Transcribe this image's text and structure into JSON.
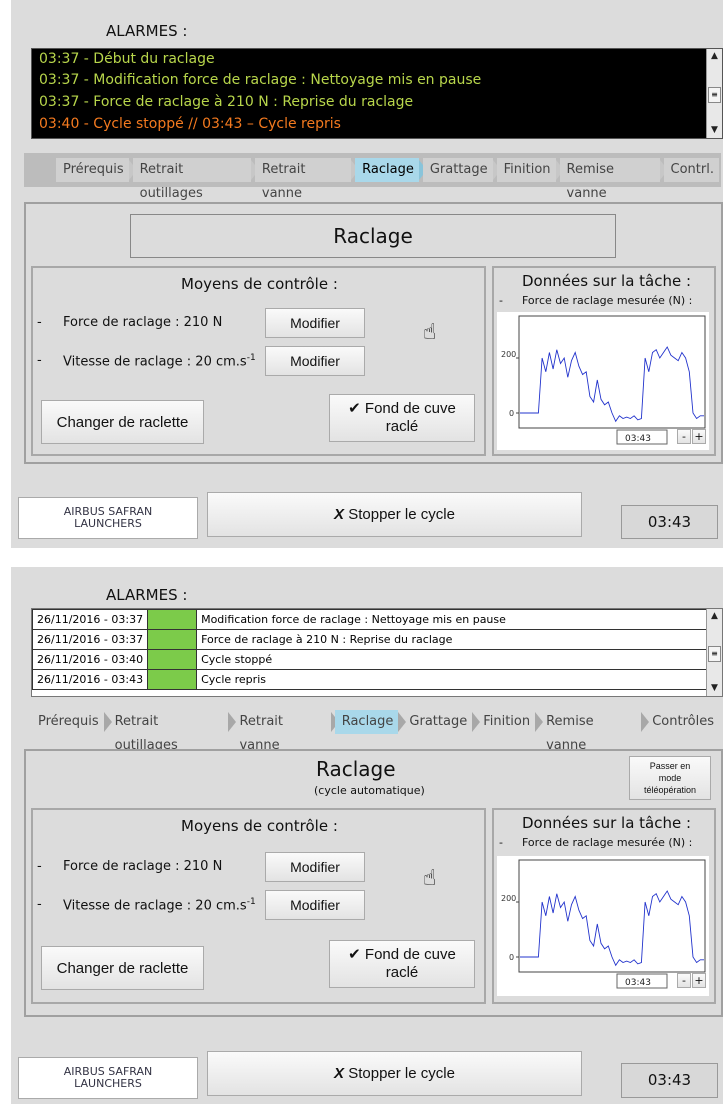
{
  "colors": {
    "alarm_green": "#b8d64b",
    "alarm_orange": "#f47a1f",
    "status_green": "#7ccb4a",
    "active_tab": "#a9d8ea",
    "chart_line": "#2233cc"
  },
  "screen1": {
    "alarm_title": "ALARMES :",
    "alarms": [
      {
        "text": "03:37 - Début du raclage",
        "color": "green"
      },
      {
        "text": "03:37 - Modification force de raclage : Nettoyage mis en pause",
        "color": "green"
      },
      {
        "text": "03:37 - Force de raclage à 210 N : Reprise du raclage",
        "color": "green"
      },
      {
        "text": "03:40 - Cycle stoppé // 03:43 – Cycle repris",
        "color": "orange"
      }
    ],
    "steps": [
      "Prérequis",
      "Retrait outillages",
      "Retrait vanne",
      "Raclage",
      "Grattage",
      "Finition",
      "Remise vanne",
      "Contrl."
    ],
    "active_step": "Raclage",
    "title": "Raclage",
    "controls_title": "Moyens de contrôle :",
    "force_label": "Force de raclage : 210 N",
    "speed_label": "Vitesse de raclage : 20 cm.s",
    "speed_exp": "-1",
    "modify_label": "Modifier",
    "change_label": "Changer de raclette",
    "fond_line1": "✔ Fond de cuve",
    "fond_line2": "raclé",
    "data_title": "Données sur la tâche :",
    "data_sub": "Force de raclage mesurée (N) :",
    "chart_time": "03:43",
    "minus": "-",
    "plus": "+",
    "logo_line1": "AIRBUS SAFRAN",
    "logo_line2": "LAUNCHERS",
    "stop_label": "Stopper le cycle",
    "stop_icon": "X",
    "time": "03:43"
  },
  "screen2": {
    "alarm_title": "ALARMES :",
    "alarms": [
      {
        "date": "26/11/2016 - 03:37",
        "msg": "Modification force de raclage : Nettoyage mis en pause"
      },
      {
        "date": "26/11/2016 - 03:37",
        "msg": "Force de raclage à 210 N : Reprise du raclage"
      },
      {
        "date": "26/11/2016 - 03:40",
        "msg": "Cycle stoppé"
      },
      {
        "date": "26/11/2016 - 03:43",
        "msg": "Cycle repris"
      }
    ],
    "steps": [
      "Prérequis",
      "Retrait outillages",
      "Retrait vanne",
      "Raclage",
      "Grattage",
      "Finition",
      "Remise vanne",
      "Contrôles"
    ],
    "active_step": "Raclage",
    "title": "Raclage",
    "subtitle": "(cycle automatique)",
    "teleop_line1": "Passer en",
    "teleop_line2": "mode",
    "teleop_line3": "téléopération",
    "controls_title": "Moyens de contrôle :",
    "force_label": "Force de raclage : 210 N",
    "speed_label": "Vitesse de raclage : 20 cm.s",
    "speed_exp": "-1",
    "modify_label": "Modifier",
    "change_label": "Changer de raclette",
    "fond_line1": "✔ Fond de cuve",
    "fond_line2": "raclé",
    "data_title": "Données sur la tâche :",
    "data_sub": "Force de raclage mesurée (N) :",
    "chart_time": "03:43",
    "minus": "-",
    "plus": "+",
    "logo_line1": "AIRBUS SAFRAN",
    "logo_line2": "LAUNCHERS",
    "stop_label": "Stopper le cycle",
    "stop_icon": "X",
    "time": "03:43"
  },
  "chart_data": [
    {
      "type": "line",
      "yticks": [
        "0",
        "200"
      ],
      "xtick": "03:43",
      "series": [
        {
          "values": [
            0,
            0,
            0,
            0,
            0,
            0,
            200,
            150,
            220,
            160,
            230,
            180,
            200,
            130,
            190,
            220,
            170,
            140,
            150,
            60,
            40,
            120,
            50,
            30,
            40,
            0,
            -30,
            -10,
            -20,
            -15,
            -20,
            -10,
            -25,
            -20,
            200,
            150,
            220,
            230,
            200,
            220,
            240,
            210,
            200,
            190,
            220,
            200,
            150,
            0,
            -20,
            -10,
            -10
          ]
        }
      ]
    },
    {
      "type": "line",
      "yticks": [
        "0",
        "200"
      ],
      "xtick": "03:43",
      "series": [
        {
          "values": [
            0,
            0,
            0,
            0,
            0,
            0,
            200,
            150,
            220,
            160,
            230,
            180,
            200,
            130,
            190,
            220,
            170,
            140,
            150,
            60,
            40,
            120,
            50,
            30,
            40,
            0,
            -30,
            -10,
            -20,
            -15,
            -20,
            -10,
            -25,
            -20,
            200,
            150,
            220,
            230,
            200,
            220,
            240,
            210,
            200,
            190,
            220,
            200,
            150,
            0,
            -20,
            -10,
            -10
          ]
        }
      ]
    }
  ]
}
